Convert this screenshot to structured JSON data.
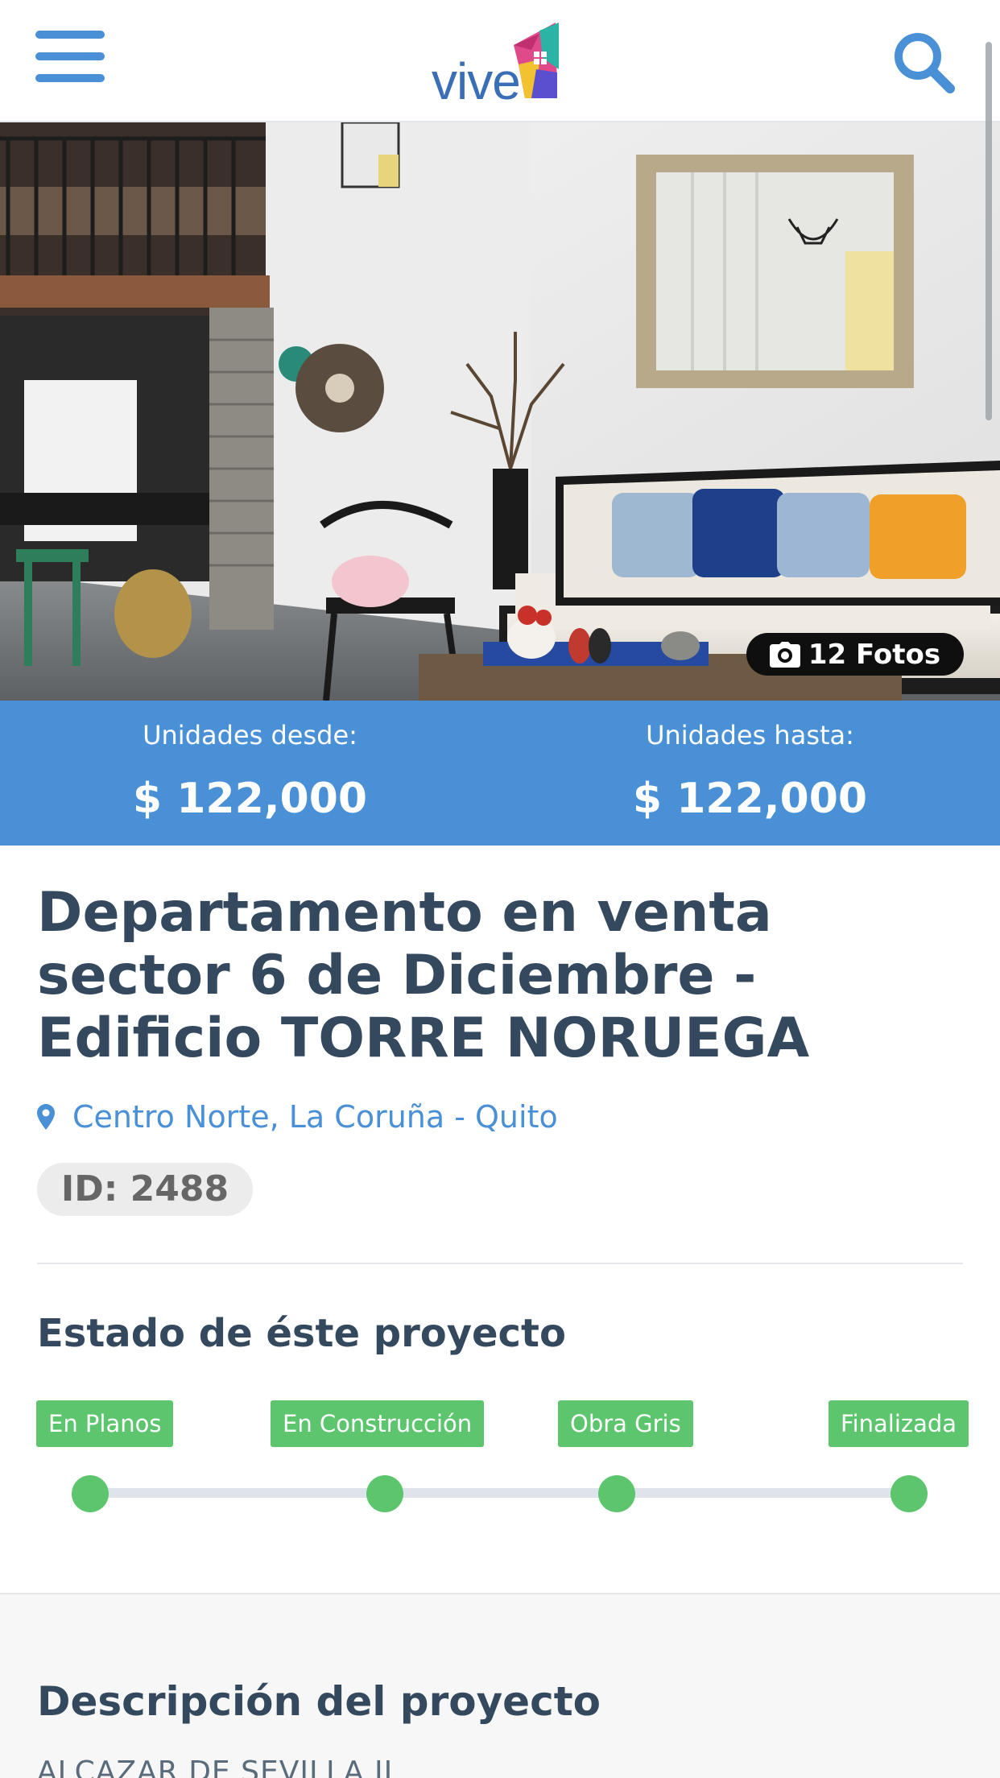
{
  "header": {
    "logo_text": "vive",
    "menu_icon": "hamburger-menu-icon",
    "search_icon": "search-icon"
  },
  "hero": {
    "photo_count_label": "12 Fotos",
    "camera_icon": "camera-icon"
  },
  "prices": {
    "from_label": "Unidades desde:",
    "from_value": "$ 122,000",
    "to_label": "Unidades hasta:",
    "to_value": "$ 122,000"
  },
  "property": {
    "title": "Departamento en venta sector 6 de Diciembre - Edificio TORRE NORUEGA",
    "location": "Centro Norte, La Coruña - Quito",
    "id_label": "ID: 2488"
  },
  "status": {
    "heading": "Estado de éste proyecto",
    "stages": [
      "En Planos",
      "En Construcción",
      "Obra Gris",
      "Finalizada"
    ]
  },
  "description": {
    "heading": "Descripción del proyecto",
    "subheading": "ALCAZAR DE SEVILLA II"
  },
  "colors": {
    "brand_blue": "#4a90d6",
    "title_text": "#34495e",
    "stage_green": "#5ec56f"
  }
}
